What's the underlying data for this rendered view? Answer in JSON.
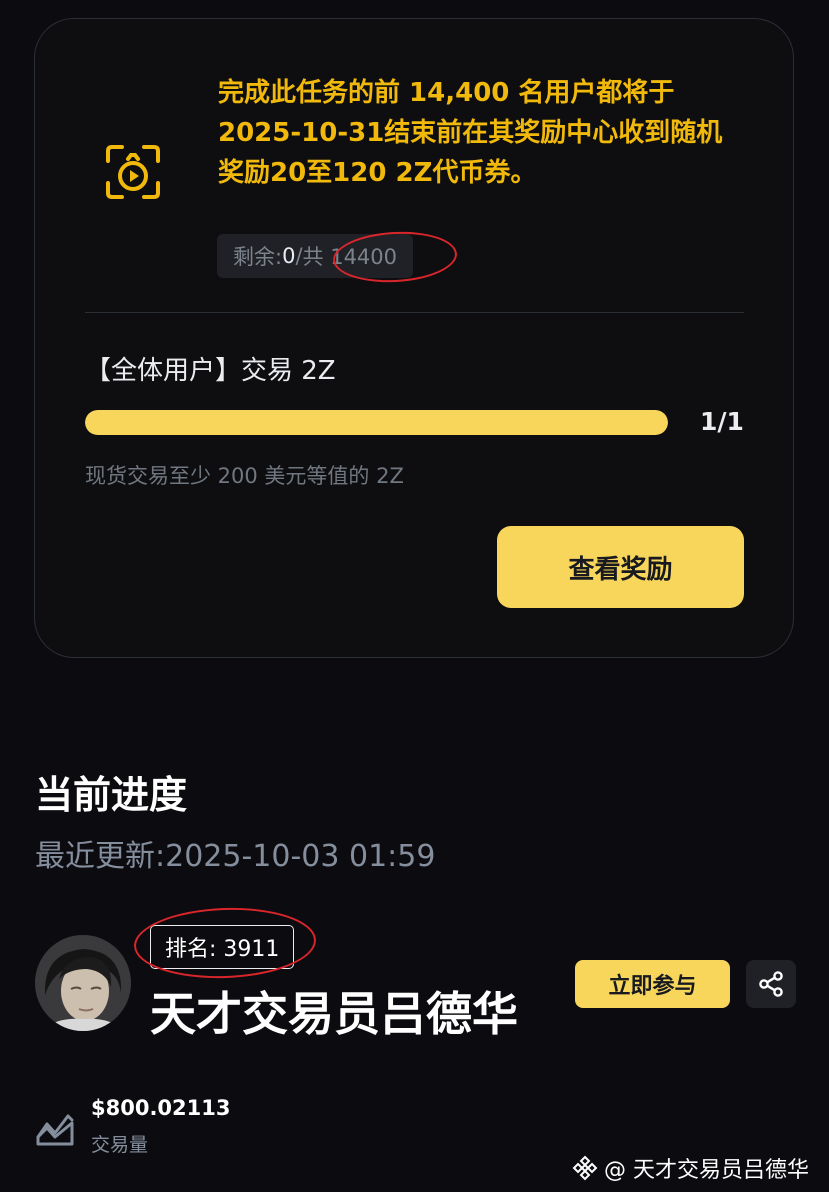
{
  "task": {
    "description": "完成此任务的前 14,400 名用户都将于 2025-10-31结束前在其奖励中心收到随机奖励20至120 2Z代币券。",
    "remaining_label": "剩余:",
    "remaining_count": "0",
    "remaining_separator": " / ",
    "remaining_total": "共 14400",
    "title": "【全体用户】交易 2Z",
    "progress_text": "1/1",
    "progress_fraction": 1.0,
    "requirement": "现货交易至少 200 美元等值的 2Z",
    "view_reward_label": "查看奖励"
  },
  "progress_section": {
    "title": "当前进度",
    "last_updated": "最近更新:2025-10-03 01:59"
  },
  "user": {
    "rank": "排名: 3911",
    "name": "天才交易员吕德华",
    "join_label": "立即参与"
  },
  "stats": {
    "volume_value": "$800.02113",
    "volume_label": "交易量"
  },
  "watermark": {
    "text": "@ 天才交易员吕德华"
  },
  "colors": {
    "background": "#0c0b0f",
    "accent_yellow": "#f8d65b",
    "description_gold": "#f0b90b",
    "annotation_red": "#d9262b"
  },
  "icons": {
    "reward": "scan-coin-icon",
    "share": "share-icon",
    "volume": "trend-chart-icon",
    "watermark": "binance-logo-icon"
  }
}
